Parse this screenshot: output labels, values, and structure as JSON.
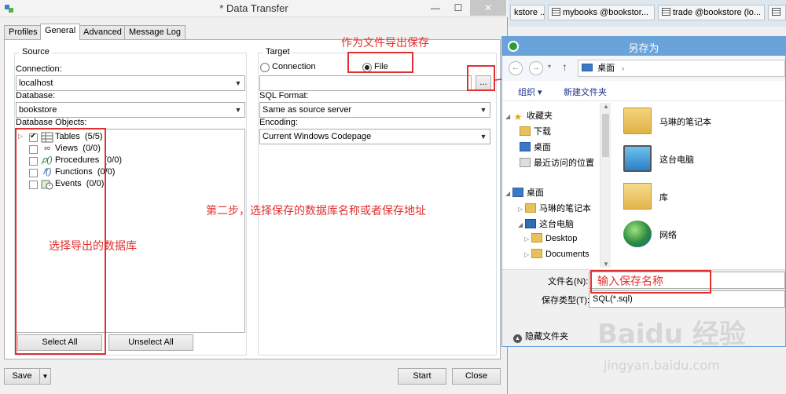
{
  "window": {
    "title": "* Data Transfer",
    "minimize": "—",
    "maximize": "☐",
    "close": "✕"
  },
  "tabs": [
    {
      "label": "Profiles"
    },
    {
      "label": "General"
    },
    {
      "label": "Advanced"
    },
    {
      "label": "Message Log"
    }
  ],
  "source": {
    "legend": "Source",
    "connection_label": "Connection:",
    "connection_value": "localhost",
    "database_label": "Database:",
    "database_value": "bookstore",
    "objects_label": "Database Objects:",
    "objects": [
      {
        "name": "Tables",
        "count": "(5/5)",
        "icon": "table-icon",
        "checked": true,
        "expandable": true
      },
      {
        "name": "Views",
        "count": "(0/0)",
        "icon": "view-icon",
        "checked": false,
        "expandable": false
      },
      {
        "name": "Procedures",
        "count": "(0/0)",
        "icon": "procedure-icon",
        "checked": false,
        "expandable": false
      },
      {
        "name": "Functions",
        "count": "(0/0)",
        "icon": "function-icon",
        "checked": false,
        "expandable": false
      },
      {
        "name": "Events",
        "count": "(0/0)",
        "icon": "event-icon",
        "checked": false,
        "expandable": false
      }
    ],
    "select_all": "Select All",
    "unselect_all": "Unselect All"
  },
  "target": {
    "legend": "Target",
    "option_connection": "Connection",
    "option_file": "File",
    "selected_option": "File",
    "file_path": "",
    "browse": "...",
    "sql_format_label": "SQL Format:",
    "sql_format_value": "Same as source server",
    "encoding_label": "Encoding:",
    "encoding_value": "Current Windows Codepage"
  },
  "footer": {
    "save": "Save",
    "start": "Start",
    "close": "Close"
  },
  "annotations": {
    "export_as_file": "作为文件导出保存",
    "step_two": "第二步，选择保存的数据库名称或者保存地址",
    "select_database": "选择导出的数据库",
    "enter_name": "输入保存名称"
  },
  "browser_tabs": [
    {
      "label": "kstore ..."
    },
    {
      "label": "mybooks @bookstor..."
    },
    {
      "label": "trade @bookstore (lo..."
    },
    {
      "label": ""
    }
  ],
  "save_dialog": {
    "title": "另存为",
    "address": "桌面",
    "organize": "组织 ▾",
    "new_folder": "新建文件夹",
    "nav_items": [
      {
        "label": "收藏夹",
        "icon": "star-icon",
        "indent": 0,
        "expander": "◢"
      },
      {
        "label": "下载",
        "icon": "download-folder-icon",
        "indent": 1,
        "expander": ""
      },
      {
        "label": "桌面",
        "icon": "desktop-icon",
        "indent": 1,
        "expander": ""
      },
      {
        "label": "最近访问的位置",
        "icon": "recent-places-icon",
        "indent": 1,
        "expander": ""
      },
      {
        "label": "桌面",
        "icon": "desktop-icon",
        "indent": 0,
        "expander": "◢"
      },
      {
        "label": "马琳的笔记本",
        "icon": "folder-icon",
        "indent": 1,
        "expander": "▷"
      },
      {
        "label": "这台电脑",
        "icon": "computer-icon",
        "indent": 1,
        "expander": "◢"
      },
      {
        "label": "Desktop",
        "icon": "folder-icon",
        "indent": 2,
        "expander": "▷"
      },
      {
        "label": "Documents",
        "icon": "folder-icon",
        "indent": 2,
        "expander": "▷"
      }
    ],
    "files": [
      {
        "label": "马琳的笔记本",
        "icon": "user-folder-icon"
      },
      {
        "label": "这台电脑",
        "icon": "computer-icon"
      },
      {
        "label": "库",
        "icon": "library-icon"
      },
      {
        "label": "网络",
        "icon": "network-icon"
      }
    ],
    "filename_label": "文件名(N):",
    "filename_value": "",
    "filetype_label": "保存类型(T):",
    "filetype_value": "SQL(*.sql)",
    "hide_folders": "隐藏文件夹"
  },
  "watermark": {
    "logo": "Baidu 经验",
    "url": "jingyan.baidu.com"
  },
  "colors": {
    "annotation": "#e13030",
    "dialog_titlebar": "#6aa3da",
    "link": "#1e3287"
  }
}
